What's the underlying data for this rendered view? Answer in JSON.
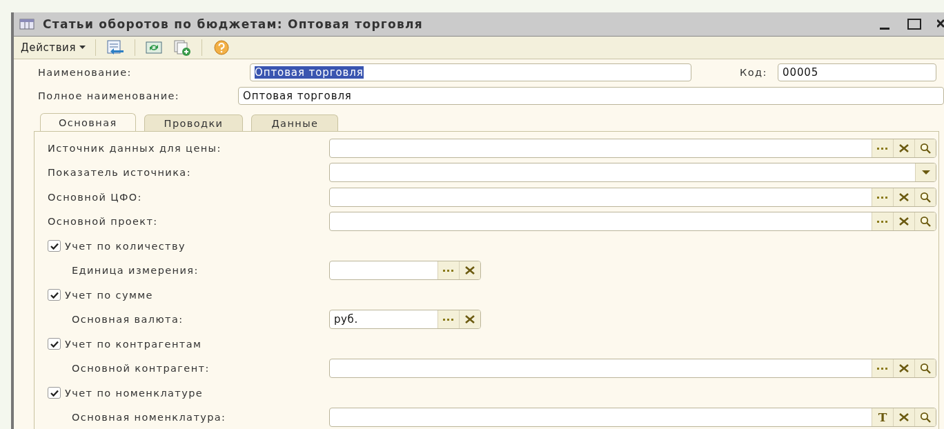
{
  "window": {
    "title": "Статьи оборотов по бюджетам: Оптовая торговля"
  },
  "toolbar": {
    "actions_label": "Действия",
    "icons": [
      {
        "kind": "post"
      },
      {
        "kind": "refresh"
      },
      {
        "kind": "copy"
      },
      {
        "kind": "help"
      }
    ]
  },
  "header_fields": {
    "name": {
      "label": "Наименование:",
      "value": "Оптовая торговля",
      "text_selected": true
    },
    "code": {
      "label": "Код:",
      "value": "00005"
    },
    "full_name": {
      "label": "Полное наименование:",
      "value": "Оптовая торговля"
    }
  },
  "tabs": [
    {
      "label": "Основная",
      "selected": true
    },
    {
      "label": "Проводки",
      "selected": false
    },
    {
      "label": "Данные",
      "selected": false
    }
  ],
  "rows": [
    {
      "kind": "field",
      "label": "Источник данных для цены:",
      "indent": false,
      "short": false,
      "buttons": [
        {
          "kind": "select"
        },
        {
          "kind": "clear"
        },
        {
          "kind": "search"
        }
      ]
    },
    {
      "kind": "field",
      "label": "Показатель источника:",
      "indent": false,
      "short": false,
      "buttons": [
        {
          "kind": "dropdown"
        }
      ]
    },
    {
      "kind": "field",
      "label": "Основной ЦФО:",
      "indent": false,
      "short": false,
      "buttons": [
        {
          "kind": "select"
        },
        {
          "kind": "clear"
        },
        {
          "kind": "search"
        }
      ]
    },
    {
      "kind": "field",
      "label": "Основной проект:",
      "indent": false,
      "short": false,
      "buttons": [
        {
          "kind": "select"
        },
        {
          "kind": "clear"
        },
        {
          "kind": "search"
        }
      ]
    },
    {
      "kind": "checkbox",
      "label": "Учет по количеству",
      "checked": true
    },
    {
      "kind": "field",
      "label": "Единица измерения:",
      "indent": true,
      "short": true,
      "buttons": [
        {
          "kind": "select"
        },
        {
          "kind": "clear"
        }
      ]
    },
    {
      "kind": "checkbox",
      "label": "Учет по сумме",
      "checked": true
    },
    {
      "kind": "field",
      "label": "Основная валюта:",
      "indent": true,
      "short": true,
      "value": "руб.",
      "buttons": [
        {
          "kind": "select"
        },
        {
          "kind": "clear"
        }
      ]
    },
    {
      "kind": "checkbox",
      "label": "Учет по контрагентам",
      "checked": true
    },
    {
      "kind": "field",
      "label": "Основной контрагент:",
      "indent": true,
      "short": false,
      "buttons": [
        {
          "kind": "select"
        },
        {
          "kind": "clear"
        },
        {
          "kind": "search"
        }
      ]
    },
    {
      "kind": "checkbox",
      "label": "Учет по номенклатуре",
      "checked": true
    },
    {
      "kind": "field",
      "label": "Основная номенклатура:",
      "indent": true,
      "short": false,
      "buttons": [
        {
          "kind": "text",
          "label": "T"
        },
        {
          "kind": "clear"
        },
        {
          "kind": "search"
        }
      ]
    }
  ]
}
